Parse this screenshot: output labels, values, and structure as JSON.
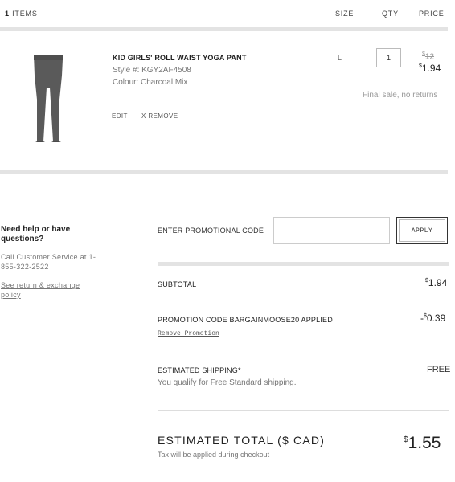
{
  "header": {
    "items_count": "1",
    "items_label": "ITEMS",
    "size_label": "SIZE",
    "qty_label": "QTY",
    "price_label": "PRICE"
  },
  "product": {
    "name": "KID GIRLS' ROLL WAIST YOGA PANT",
    "style": "Style #: KGY2AF4508",
    "colour": "Colour: Charcoal Mix",
    "size": "L",
    "quantity": "1",
    "original_price_symbol": "$",
    "original_price": "12",
    "sale_price_symbol": "$",
    "sale_price": "1.94",
    "final_sale_note": "Final sale, no returns",
    "edit_label": "EDIT",
    "remove_label": "X REMOVE",
    "image_icon": "yoga-pant-image",
    "pant_color": "#5a5a5a"
  },
  "help": {
    "title": "Need help or have questions?",
    "call_text": "Call Customer Service at 1-855-322-2522",
    "policy_link": "See return & exchange policy"
  },
  "promo": {
    "label": "ENTER PROMOTIONAL CODE",
    "input_value": "",
    "input_placeholder": "",
    "apply_label": "APPLY"
  },
  "summary": {
    "subtotal_label": "SUBTOTAL",
    "subtotal_symbol": "$",
    "subtotal_value": "1.94",
    "promo_applied_label": "PROMOTION CODE BARGAINMOOSE20 APPLIED",
    "promo_discount_prefix": "-",
    "promo_discount_symbol": "$",
    "promo_discount_value": "0.39",
    "remove_promo_label": "Remove Promotion",
    "shipping_label": "ESTIMATED SHIPPING*",
    "shipping_value": "FREE",
    "shipping_note": "You qualify for Free Standard shipping.",
    "total_label": "ESTIMATED TOTAL ($ CAD)",
    "total_note": "Tax will be applied during checkout",
    "total_symbol": "$",
    "total_value": "1.55"
  }
}
